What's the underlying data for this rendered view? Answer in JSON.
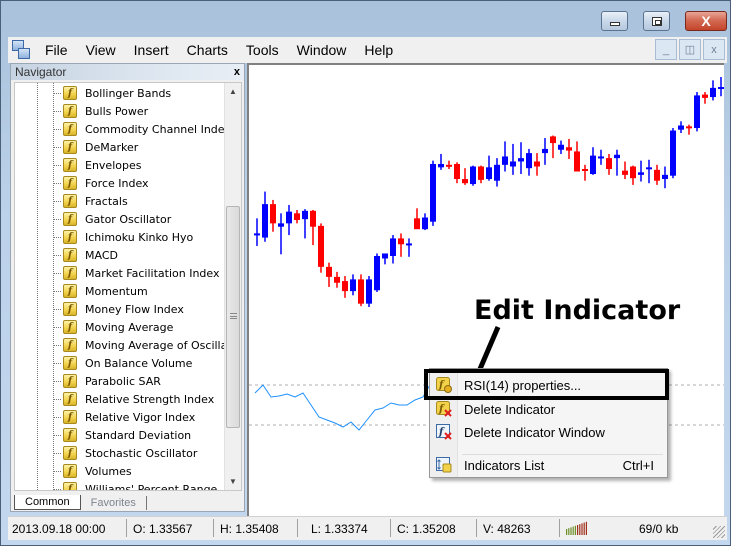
{
  "window": {
    "title": "",
    "caption_buttons": {
      "minimize": "minimize",
      "maximize": "maximize",
      "close": "X"
    }
  },
  "menubar": {
    "items": [
      "File",
      "View",
      "Insert",
      "Charts",
      "Tools",
      "Window",
      "Help"
    ],
    "mdi_buttons": {
      "minimize": "_",
      "restore": "🗗",
      "close": "x"
    }
  },
  "navigator": {
    "title": "Navigator",
    "close": "x",
    "items": [
      "Bollinger Bands",
      "Bulls Power",
      "Commodity Channel Index",
      "DeMarker",
      "Envelopes",
      "Force Index",
      "Fractals",
      "Gator Oscillator",
      "Ichimoku Kinko Hyo",
      "MACD",
      "Market Facilitation Index",
      "Momentum",
      "Money Flow Index",
      "Moving Average",
      "Moving Average of Oscillat",
      "On Balance Volume",
      "Parabolic SAR",
      "Relative Strength Index",
      "Relative Vigor Index",
      "Standard Deviation",
      "Stochastic Oscillator",
      "Volumes",
      "Williams' Percent Range"
    ],
    "item_icon": "indicator-f-icon",
    "tabs": [
      "Common",
      "Favorites"
    ],
    "active_tab": "Common"
  },
  "annotation": {
    "label": "Edit Indicator"
  },
  "context_menu": {
    "items": [
      {
        "label": "RSI(14) properties...",
        "icon": "indicator-properties-icon",
        "shortcut": ""
      },
      {
        "label": "Delete Indicator",
        "icon": "delete-indicator-icon",
        "shortcut": ""
      },
      {
        "label": "Delete Indicator Window",
        "icon": "delete-indicator-window-icon",
        "shortcut": ""
      },
      {
        "label": "Indicators List",
        "icon": "indicators-list-icon",
        "shortcut": "Ctrl+I"
      }
    ]
  },
  "statusbar": {
    "datetime": "2013.09.18 00:00",
    "open": "O: 1.33567",
    "high": "H: 1.35408",
    "low": "L: 1.33374",
    "close": "C: 1.35208",
    "volume": "V: 48263",
    "traffic": "69/0 kb"
  },
  "colors": {
    "bull": "#0000ff",
    "bear": "#ff0000",
    "rsi_line": "#1e90ff",
    "rsi_levels": "#b0b0b0"
  },
  "chart_data": {
    "type": "candlestick",
    "title": "",
    "price_panel": {
      "candles": [
        {
          "o": 1.321,
          "h": 1.3228,
          "l": 1.3195,
          "c": 1.321
        },
        {
          "o": 1.3205,
          "h": 1.326,
          "l": 1.32,
          "c": 1.3245
        },
        {
          "o": 1.3245,
          "h": 1.325,
          "l": 1.3212,
          "c": 1.3222
        },
        {
          "o": 1.3218,
          "h": 1.3234,
          "l": 1.3185,
          "c": 1.3222
        },
        {
          "o": 1.3222,
          "h": 1.3244,
          "l": 1.3208,
          "c": 1.3236
        },
        {
          "o": 1.3234,
          "h": 1.3238,
          "l": 1.3222,
          "c": 1.3226
        },
        {
          "o": 1.3227,
          "h": 1.3239,
          "l": 1.3204,
          "c": 1.3237
        },
        {
          "o": 1.3237,
          "h": 1.3238,
          "l": 1.3196,
          "c": 1.3218
        },
        {
          "o": 1.3219,
          "h": 1.3222,
          "l": 1.3163,
          "c": 1.317
        },
        {
          "o": 1.317,
          "h": 1.3175,
          "l": 1.3146,
          "c": 1.3158
        },
        {
          "o": 1.3158,
          "h": 1.3164,
          "l": 1.3145,
          "c": 1.3151
        },
        {
          "o": 1.3153,
          "h": 1.3159,
          "l": 1.3133,
          "c": 1.3141
        },
        {
          "o": 1.3141,
          "h": 1.3161,
          "l": 1.3136,
          "c": 1.3155
        },
        {
          "o": 1.3155,
          "h": 1.3161,
          "l": 1.3123,
          "c": 1.3126
        },
        {
          "o": 1.3126,
          "h": 1.3159,
          "l": 1.3122,
          "c": 1.3155
        },
        {
          "o": 1.3142,
          "h": 1.3186,
          "l": 1.314,
          "c": 1.3183
        },
        {
          "o": 1.318,
          "h": 1.3186,
          "l": 1.3173,
          "c": 1.3186
        },
        {
          "o": 1.3183,
          "h": 1.3208,
          "l": 1.3174,
          "c": 1.3204
        },
        {
          "o": 1.3204,
          "h": 1.321,
          "l": 1.3182,
          "c": 1.3197
        },
        {
          "o": 1.3198,
          "h": 1.3204,
          "l": 1.3182,
          "c": 1.3198
        },
        {
          "o": 1.3228,
          "h": 1.324,
          "l": 1.322,
          "c": 1.3215
        },
        {
          "o": 1.3215,
          "h": 1.3234,
          "l": 1.3214,
          "c": 1.3229
        },
        {
          "o": 1.3224,
          "h": 1.3297,
          "l": 1.3219,
          "c": 1.3293
        },
        {
          "o": 1.3289,
          "h": 1.3305,
          "l": 1.3286,
          "c": 1.3293
        },
        {
          "o": 1.3292,
          "h": 1.3297,
          "l": 1.3287,
          "c": 1.3291
        },
        {
          "o": 1.3293,
          "h": 1.3295,
          "l": 1.327,
          "c": 1.3275
        },
        {
          "o": 1.3275,
          "h": 1.3288,
          "l": 1.3268,
          "c": 1.327
        },
        {
          "o": 1.3269,
          "h": 1.3291,
          "l": 1.3267,
          "c": 1.329
        },
        {
          "o": 1.329,
          "h": 1.3291,
          "l": 1.327,
          "c": 1.3274
        },
        {
          "o": 1.3275,
          "h": 1.3303,
          "l": 1.3273,
          "c": 1.3289
        },
        {
          "o": 1.3273,
          "h": 1.33,
          "l": 1.3266,
          "c": 1.3292
        },
        {
          "o": 1.3292,
          "h": 1.332,
          "l": 1.3284,
          "c": 1.3302
        },
        {
          "o": 1.329,
          "h": 1.3317,
          "l": 1.328,
          "c": 1.3296
        },
        {
          "o": 1.3296,
          "h": 1.3319,
          "l": 1.3281,
          "c": 1.33
        },
        {
          "o": 1.3288,
          "h": 1.3311,
          "l": 1.3279,
          "c": 1.3306
        },
        {
          "o": 1.3296,
          "h": 1.3306,
          "l": 1.3279,
          "c": 1.329
        },
        {
          "o": 1.3306,
          "h": 1.3324,
          "l": 1.3292,
          "c": 1.3311
        },
        {
          "o": 1.3326,
          "h": 1.3327,
          "l": 1.33,
          "c": 1.3318
        },
        {
          "o": 1.331,
          "h": 1.3321,
          "l": 1.3305,
          "c": 1.3316
        },
        {
          "o": 1.3313,
          "h": 1.3323,
          "l": 1.3299,
          "c": 1.3309
        },
        {
          "o": 1.3308,
          "h": 1.332,
          "l": 1.3287,
          "c": 1.3284
        },
        {
          "o": 1.3287,
          "h": 1.3292,
          "l": 1.3273,
          "c": 1.3286
        },
        {
          "o": 1.3281,
          "h": 1.3313,
          "l": 1.328,
          "c": 1.3303
        },
        {
          "o": 1.3302,
          "h": 1.331,
          "l": 1.3292,
          "c": 1.3302
        },
        {
          "o": 1.33,
          "h": 1.3305,
          "l": 1.328,
          "c": 1.3287
        },
        {
          "o": 1.33,
          "h": 1.331,
          "l": 1.3279,
          "c": 1.3304
        },
        {
          "o": 1.3285,
          "h": 1.3296,
          "l": 1.3275,
          "c": 1.328
        },
        {
          "o": 1.329,
          "h": 1.3291,
          "l": 1.3268,
          "c": 1.3276
        },
        {
          "o": 1.328,
          "h": 1.3297,
          "l": 1.3272,
          "c": 1.3283
        },
        {
          "o": 1.3287,
          "h": 1.3298,
          "l": 1.327,
          "c": 1.3289
        },
        {
          "o": 1.3286,
          "h": 1.3292,
          "l": 1.3268,
          "c": 1.3273
        },
        {
          "o": 1.3275,
          "h": 1.329,
          "l": 1.3264,
          "c": 1.328
        },
        {
          "o": 1.3279,
          "h": 1.3336,
          "l": 1.3276,
          "c": 1.3333
        },
        {
          "o": 1.3334,
          "h": 1.3344,
          "l": 1.333,
          "c": 1.3339
        },
        {
          "o": 1.3338,
          "h": 1.334,
          "l": 1.3328,
          "c": 1.3336
        },
        {
          "o": 1.3336,
          "h": 1.3379,
          "l": 1.3332,
          "c": 1.3375
        },
        {
          "o": 1.3376,
          "h": 1.3379,
          "l": 1.3365,
          "c": 1.3372
        },
        {
          "o": 1.3373,
          "h": 1.3393,
          "l": 1.3369,
          "c": 1.3384
        },
        {
          "o": 1.3384,
          "h": 1.3397,
          "l": 1.3374,
          "c": 1.3385
        },
        {
          "o": 1.3386,
          "h": 1.3388,
          "l": 1.3384,
          "c": 1.3388
        },
        {
          "o": 1.3387,
          "h": 1.3389,
          "l": 1.3385,
          "c": 1.3389
        }
      ]
    },
    "indicator_panel": {
      "name": "RSI(14)",
      "levels": [
        70,
        30
      ],
      "ylim": [
        0,
        100
      ],
      "values": [
        62,
        70,
        58,
        59,
        61,
        58,
        62,
        50,
        38,
        35,
        32,
        28,
        33,
        25,
        35,
        45,
        47,
        52,
        50,
        50,
        55,
        58,
        72,
        73,
        72,
        70,
        69,
        74,
        71,
        70,
        72,
        74,
        73,
        72,
        75,
        76,
        78,
        78,
        76,
        74,
        74,
        75,
        77,
        78,
        77,
        79,
        80,
        82,
        82,
        83
      ]
    }
  }
}
